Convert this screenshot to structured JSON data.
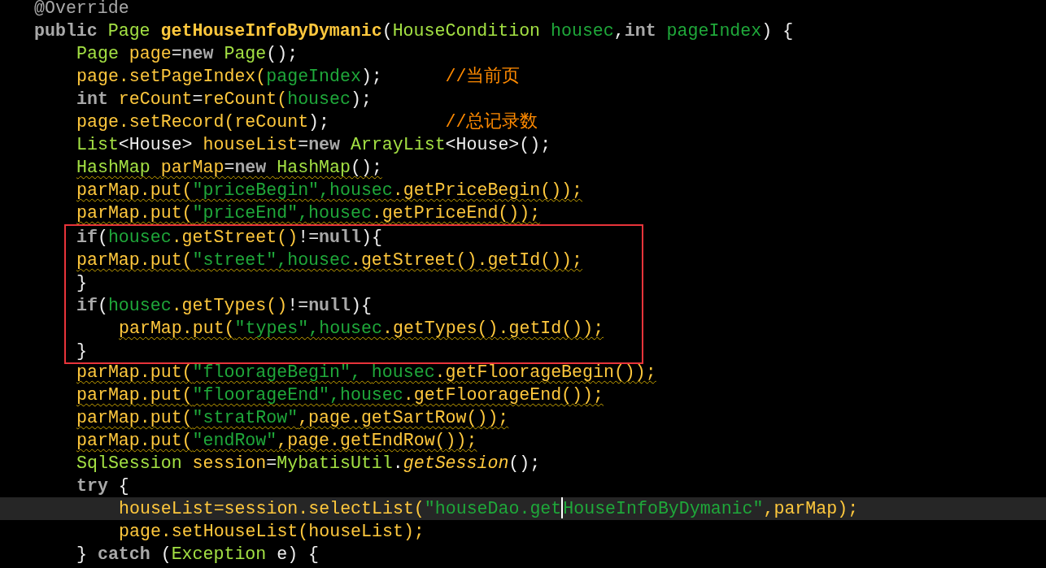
{
  "editor": {
    "lines": [
      {
        "kind": "line",
        "current": false,
        "warning": false,
        "tokens": [
          {
            "kind": "annotation",
            "text": "@Override"
          }
        ]
      },
      {
        "kind": "line",
        "current": false,
        "warning": false,
        "tokens": [
          {
            "kind": "keyword",
            "text": "public "
          },
          {
            "kind": "type",
            "text": "Page "
          },
          {
            "kind": "decl",
            "text": "getHouseInfoByDymanic"
          },
          {
            "kind": "plain",
            "text": "("
          },
          {
            "kind": "type",
            "text": "HouseCondition "
          },
          {
            "kind": "param",
            "text": "housec"
          },
          {
            "kind": "plain",
            "text": ","
          },
          {
            "kind": "keyword",
            "text": "int "
          },
          {
            "kind": "param",
            "text": "pageIndex"
          },
          {
            "kind": "plain",
            "text": ") {"
          }
        ],
        "children": [
          {
            "kind": "line",
            "current": false,
            "warning": false,
            "tokens": [
              {
                "kind": "type",
                "text": "Page "
              },
              {
                "kind": "member",
                "text": "page"
              },
              {
                "kind": "plain",
                "text": "="
              },
              {
                "kind": "keyword",
                "text": "new "
              },
              {
                "kind": "type",
                "text": "Page"
              },
              {
                "kind": "plain",
                "text": "();"
              }
            ]
          },
          {
            "kind": "line",
            "current": false,
            "warning": false,
            "tokens": [
              {
                "kind": "member",
                "text": "page.setPageIndex("
              },
              {
                "kind": "param",
                "text": "pageIndex"
              },
              {
                "kind": "plain",
                "text": ");      "
              },
              {
                "kind": "comment",
                "text": "//当前页"
              }
            ]
          },
          {
            "kind": "line",
            "current": false,
            "warning": false,
            "tokens": [
              {
                "kind": "keyword",
                "text": "int "
              },
              {
                "kind": "member",
                "text": "reCount"
              },
              {
                "kind": "plain",
                "text": "="
              },
              {
                "kind": "member",
                "text": "reCount("
              },
              {
                "kind": "param",
                "text": "housec"
              },
              {
                "kind": "plain",
                "text": ");"
              }
            ]
          },
          {
            "kind": "line",
            "current": false,
            "warning": false,
            "tokens": [
              {
                "kind": "member",
                "text": "page.setRecord(reCount"
              },
              {
                "kind": "plain",
                "text": ");           "
              },
              {
                "kind": "comment",
                "text": "//总记录数"
              }
            ]
          },
          {
            "kind": "line",
            "current": false,
            "warning": false,
            "tokens": [
              {
                "kind": "type",
                "text": "List"
              },
              {
                "kind": "plain",
                "text": "<House> "
              },
              {
                "kind": "member",
                "text": "houseList"
              },
              {
                "kind": "plain",
                "text": "="
              },
              {
                "kind": "keyword",
                "text": "new "
              },
              {
                "kind": "type",
                "text": "ArrayList"
              },
              {
                "kind": "plain",
                "text": "<House>();"
              }
            ]
          },
          {
            "kind": "line",
            "current": false,
            "warning": true,
            "tokens": [
              {
                "kind": "type",
                "text": "HashMap "
              },
              {
                "kind": "member",
                "text": "parMap"
              },
              {
                "kind": "plain",
                "text": "="
              },
              {
                "kind": "keyword",
                "text": "new "
              },
              {
                "kind": "type",
                "text": "HashMap"
              },
              {
                "kind": "plain",
                "text": "();"
              }
            ]
          },
          {
            "kind": "line",
            "current": false,
            "warning": true,
            "tokens": [
              {
                "kind": "member",
                "text": "parMap.put("
              },
              {
                "kind": "string",
                "text": "\"priceBegin\","
              },
              {
                "kind": "param",
                "text": "housec"
              },
              {
                "kind": "member",
                "text": ".getPriceBegin());"
              }
            ]
          },
          {
            "kind": "line",
            "current": false,
            "warning": true,
            "tokens": [
              {
                "kind": "member",
                "text": "parMap.put("
              },
              {
                "kind": "string",
                "text": "\"priceEnd\","
              },
              {
                "kind": "param",
                "text": "housec"
              },
              {
                "kind": "member",
                "text": ".getPriceEnd());"
              }
            ]
          },
          {
            "kind": "frame",
            "children": [
              {
                "kind": "line",
                "current": false,
                "warning": false,
                "tokens": [
                  {
                    "kind": "keyword",
                    "text": "if"
                  },
                  {
                    "kind": "plain",
                    "text": "("
                  },
                  {
                    "kind": "param",
                    "text": "housec"
                  },
                  {
                    "kind": "member",
                    "text": ".getStreet()"
                  },
                  {
                    "kind": "plain",
                    "text": "!="
                  },
                  {
                    "kind": "keyword",
                    "text": "null"
                  },
                  {
                    "kind": "plain",
                    "text": "){"
                  }
                ]
              },
              {
                "kind": "line",
                "current": false,
                "warning": true,
                "tokens": [
                  {
                    "kind": "member",
                    "text": "parMap.put("
                  },
                  {
                    "kind": "string",
                    "text": "\"street\","
                  },
                  {
                    "kind": "param",
                    "text": "housec"
                  },
                  {
                    "kind": "member",
                    "text": ".getStreet().getId());"
                  }
                ]
              },
              {
                "kind": "line",
                "current": false,
                "warning": false,
                "tokens": [
                  {
                    "kind": "plain",
                    "text": "}"
                  }
                ]
              },
              {
                "kind": "line",
                "current": false,
                "warning": false,
                "tokens": [
                  {
                    "kind": "keyword",
                    "text": "if"
                  },
                  {
                    "kind": "plain",
                    "text": "("
                  },
                  {
                    "kind": "param",
                    "text": "housec"
                  },
                  {
                    "kind": "member",
                    "text": ".getTypes()"
                  },
                  {
                    "kind": "plain",
                    "text": "!="
                  },
                  {
                    "kind": "keyword",
                    "text": "null"
                  },
                  {
                    "kind": "plain",
                    "text": "){"
                  }
                ],
                "children": [
                  {
                    "kind": "line",
                    "current": false,
                    "warning": true,
                    "tokens": [
                      {
                        "kind": "member",
                        "text": "parMap.put("
                      },
                      {
                        "kind": "string",
                        "text": "\"types\","
                      },
                      {
                        "kind": "param",
                        "text": "housec"
                      },
                      {
                        "kind": "member",
                        "text": ".getTypes().getId());"
                      }
                    ]
                  }
                ]
              },
              {
                "kind": "line",
                "current": false,
                "warning": false,
                "tokens": [
                  {
                    "kind": "plain",
                    "text": "}"
                  }
                ]
              }
            ]
          },
          {
            "kind": "line",
            "current": false,
            "warning": true,
            "tokens": [
              {
                "kind": "member",
                "text": "parMap.put("
              },
              {
                "kind": "string",
                "text": "\"floorageBegin\", "
              },
              {
                "kind": "param",
                "text": "housec"
              },
              {
                "kind": "member",
                "text": ".getFloorageBegin());"
              }
            ]
          },
          {
            "kind": "line",
            "current": false,
            "warning": true,
            "tokens": [
              {
                "kind": "member",
                "text": "parMap.put("
              },
              {
                "kind": "string",
                "text": "\"floorageEnd\","
              },
              {
                "kind": "param",
                "text": "housec"
              },
              {
                "kind": "member",
                "text": ".getFloorageEnd());"
              }
            ]
          },
          {
            "kind": "line",
            "current": false,
            "warning": true,
            "tokens": [
              {
                "kind": "member",
                "text": "parMap.put("
              },
              {
                "kind": "string",
                "text": "\"stratRow\""
              },
              {
                "kind": "member",
                "text": ",page.getSartRow());"
              }
            ]
          },
          {
            "kind": "line",
            "current": false,
            "warning": true,
            "tokens": [
              {
                "kind": "member",
                "text": "parMap.put("
              },
              {
                "kind": "string",
                "text": "\"endRow\""
              },
              {
                "kind": "member",
                "text": ",page.getEndRow());"
              }
            ]
          },
          {
            "kind": "line",
            "current": false,
            "warning": false,
            "tokens": [
              {
                "kind": "type",
                "text": "SqlSession "
              },
              {
                "kind": "member",
                "text": "session"
              },
              {
                "kind": "plain",
                "text": "="
              },
              {
                "kind": "type",
                "text": "MybatisUtil"
              },
              {
                "kind": "plain",
                "text": "."
              },
              {
                "kind": "static",
                "text": "getSession"
              },
              {
                "kind": "plain",
                "text": "();"
              }
            ]
          },
          {
            "kind": "line",
            "current": false,
            "warning": false,
            "tokens": [
              {
                "kind": "keyword",
                "text": "try"
              },
              {
                "kind": "plain",
                "text": " {"
              }
            ],
            "children": [
              {
                "kind": "line",
                "current": true,
                "warning": false,
                "tokens": [
                  {
                    "kind": "member",
                    "text": "houseList=session.selectList("
                  },
                  {
                    "kind": "string",
                    "text": "\"houseDao.get"
                  },
                  {
                    "kind": "cursor"
                  },
                  {
                    "kind": "string",
                    "text": "HouseInfoByDymanic\""
                  },
                  {
                    "kind": "member",
                    "text": ",parMap);"
                  }
                ]
              },
              {
                "kind": "line",
                "current": false,
                "warning": false,
                "tokens": [
                  {
                    "kind": "member",
                    "text": "page.setHouseList(houseList);"
                  }
                ]
              }
            ]
          },
          {
            "kind": "line",
            "current": false,
            "warning": false,
            "tokens": [
              {
                "kind": "plain",
                "text": "} "
              },
              {
                "kind": "keyword",
                "text": "catch"
              },
              {
                "kind": "plain",
                "text": " ("
              },
              {
                "kind": "type",
                "text": "Exception"
              },
              {
                "kind": "plain",
                "text": " e) {"
              }
            ]
          }
        ]
      }
    ]
  }
}
